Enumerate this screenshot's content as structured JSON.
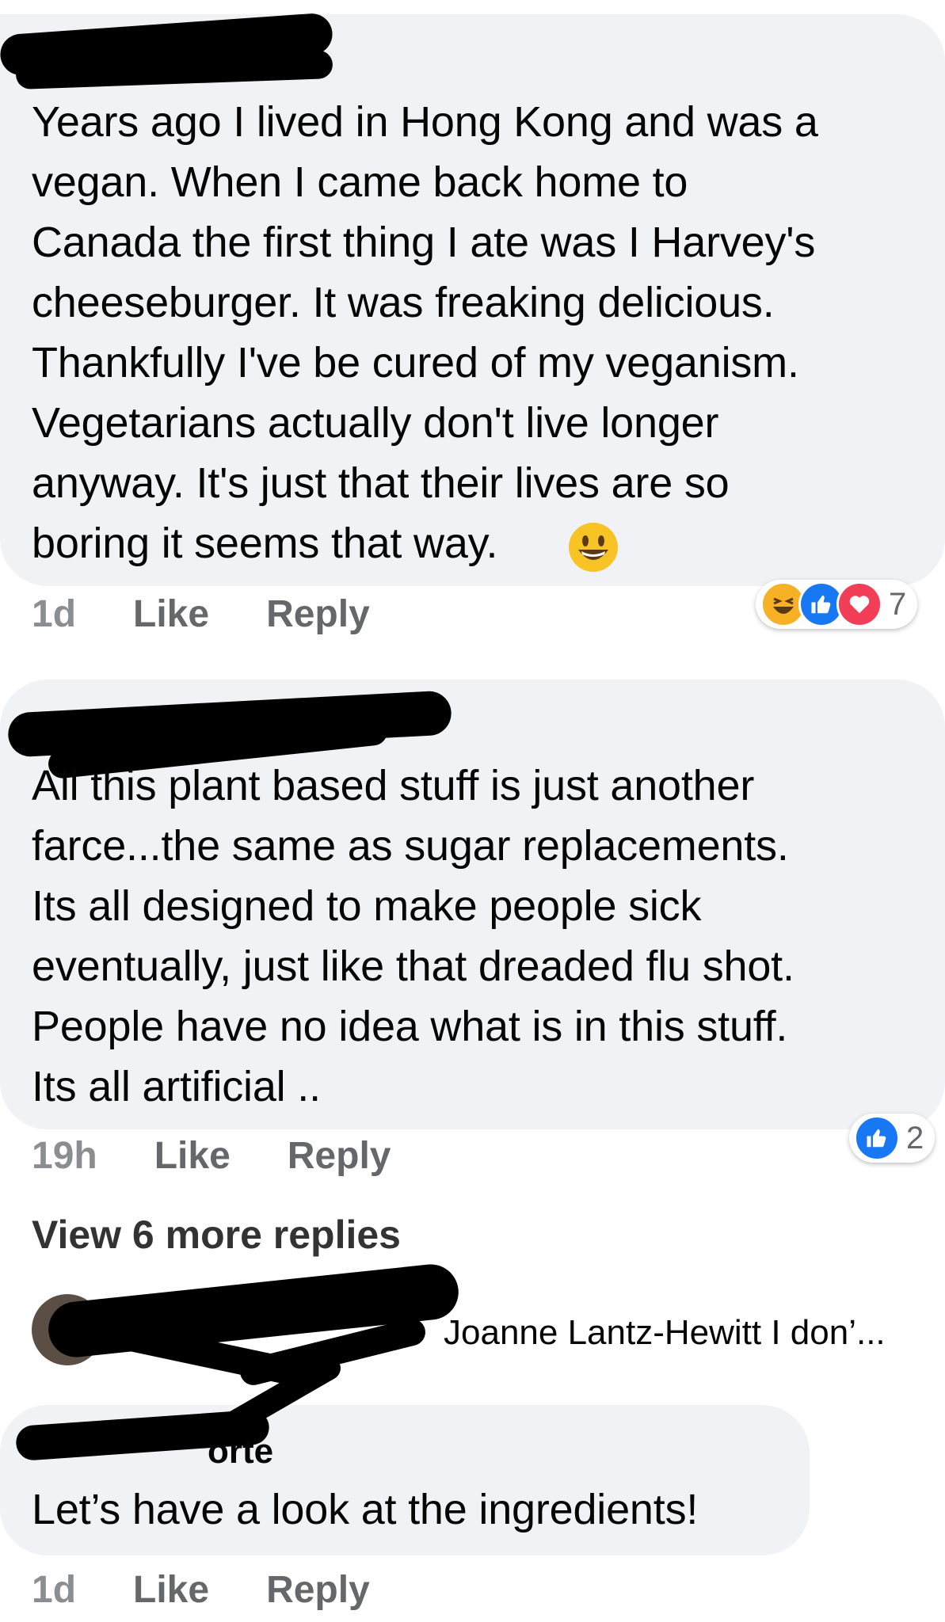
{
  "comments": [
    {
      "author_partial": "",
      "text": "Years ago I lived in Hong Kong and was a\nvegan. When I came back home to\nCanada the first thing I ate was I Harvey's\ncheeseburger. It was freaking delicious.\nThankfully I've be cured of my veganism.\nVegetarians actually don't live longer\nanyway. It's just that their lives are so\nboring it seems that way.",
      "time": "1d",
      "like_label": "Like",
      "reply_label": "Reply",
      "reaction_count": "7",
      "reaction_icons": [
        "haha-emoji-icon",
        "like-icon",
        "love-icon"
      ]
    },
    {
      "author_partial": "",
      "text": "All this plant based stuff is just another\nfarce...the same as sugar replacements.\nIts all designed to make people sick\neventually, just like that dreaded flu shot.\nPeople have no idea what is in this stuff.\nIts all artificial ..",
      "time": "19h",
      "like_label": "Like",
      "reply_label": "Reply",
      "reaction_count": "2",
      "reaction_icons": [
        "like-icon"
      ]
    }
  ],
  "view_more": "View 6 more replies",
  "reply_preview": "Joanne Lantz-Hewitt I don’...",
  "third_comment": {
    "author_partial": "orte",
    "text": "Let’s have a look at the ingredients!",
    "time": "1d",
    "like_label": "Like",
    "reply_label": "Reply"
  },
  "colors": {
    "bubble": "#f0f2f5",
    "like_blue": "#1877f2",
    "love_red": "#f33e58",
    "haha_yellow": "#f7b125",
    "meta_gray": "#65676b"
  }
}
